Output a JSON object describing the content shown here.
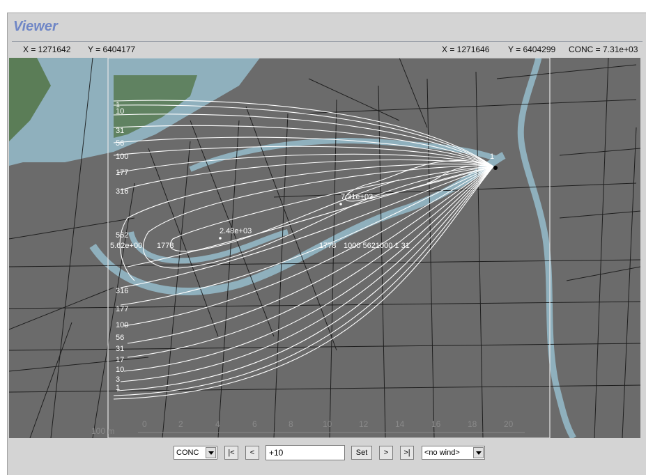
{
  "window": {
    "title": "Viewer"
  },
  "coords": {
    "left": {
      "x": "X = 1271642",
      "y": "Y = 6404177"
    },
    "right": {
      "x": "X = 1271646",
      "y": "Y = 6404299",
      "conc": "CONC = 7.31e+03"
    }
  },
  "map": {
    "labels": {
      "peak": "7.31e+03",
      "secondary": "2.48e+03",
      "left_axis": "5.62e+00",
      "mid_1778": "1778",
      "mid_1778b": "1778",
      "center_cluster": "1000 5621000 1 31",
      "source": "1"
    },
    "contour_levels": [
      "1",
      "10",
      "31",
      "56",
      "100",
      "177",
      "316",
      "562",
      "316",
      "177",
      "100",
      "56",
      "31",
      "17",
      "10",
      "3",
      "1"
    ],
    "scale": {
      "unit": "100 m",
      "ticks": [
        "0",
        "2",
        "4",
        "6",
        "8",
        "10",
        "12",
        "14",
        "16",
        "18",
        "20"
      ]
    }
  },
  "controls": {
    "variable": "CONC",
    "first": "|<",
    "prev": "<",
    "time_value": "+10",
    "set": "Set",
    "next": ">",
    "last": ">|",
    "wind": "<no wind>"
  },
  "colors": {
    "water": "#8fb0bd",
    "land": "#6b6b6b",
    "green": "#5b7d57",
    "contour": "#ffffff"
  }
}
